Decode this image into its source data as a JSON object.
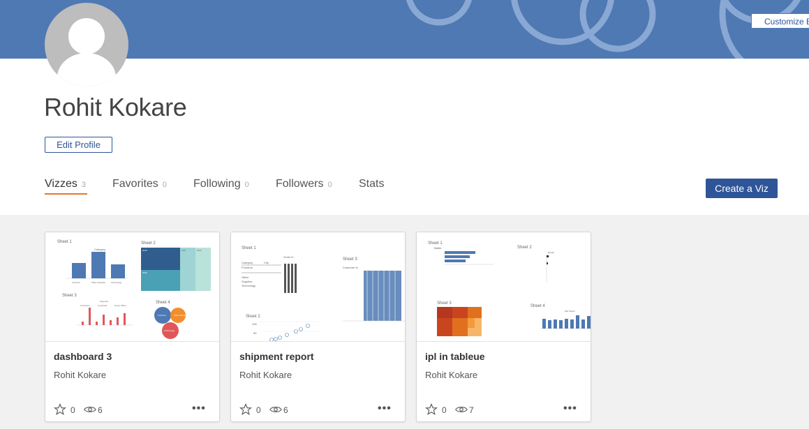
{
  "banner": {
    "customize_label": "Customize B"
  },
  "profile": {
    "name": "Rohit Kokare",
    "edit_label": "Edit Profile"
  },
  "tabs": [
    {
      "label": "Vizzes",
      "count": "3"
    },
    {
      "label": "Favorites",
      "count": "0"
    },
    {
      "label": "Following",
      "count": "0"
    },
    {
      "label": "Followers",
      "count": "0"
    },
    {
      "label": "Stats",
      "count": ""
    }
  ],
  "create_label": "Create a Viz",
  "colors": {
    "banner": "#4e79b3",
    "accent": "#e8762c",
    "primary": "#2e5597"
  },
  "cards": [
    {
      "title": "dashboard 3",
      "author": "Rohit Kokare",
      "favorites": "0",
      "views": "6",
      "sheets": [
        "Sheet 1",
        "Sheet 2",
        "Sheet 3",
        "Sheet 4"
      ],
      "thumb_text": {
        "s1_header": "Category",
        "s1_categories": [
          "Furniture",
          "Office Supplies",
          "Technology"
        ],
        "s2_labels": [
          "2019",
          "2020",
          "2021",
          "2022"
        ],
        "s3_header": "Segment",
        "s3_segments": [
          "Consumer",
          "Corporate",
          "Home Office"
        ],
        "s4_bubbles": [
          "Furniture",
          "Office Supplies",
          "Technology"
        ]
      }
    },
    {
      "title": "shipment report",
      "author": "Rohit Kokare",
      "favorites": "0",
      "views": "6",
      "sheets": [
        "Sheet 1",
        "Sheet 2",
        "Sheet 3"
      ],
      "thumb_text": {
        "s1_headers": [
          "Category",
          "City",
          "Order D.."
        ],
        "s1_rows": [
          "Furniture",
          "Office",
          "Supplies",
          "Technology"
        ],
        "s2_ticks": [
          "10K",
          "5K"
        ],
        "s3_header": "Customer N.."
      }
    },
    {
      "title": "ipl in tableue",
      "author": "Rohit Kokare",
      "favorites": "0",
      "views": "7",
      "sheets": [
        "Sheet 1",
        "Sheet 2",
        "Sheet 3",
        "Sheet 4"
      ],
      "thumb_text": {
        "s1_header": "Batter",
        "s2_header": "Bowler",
        "s4_header": "Wet Striker"
      }
    }
  ]
}
